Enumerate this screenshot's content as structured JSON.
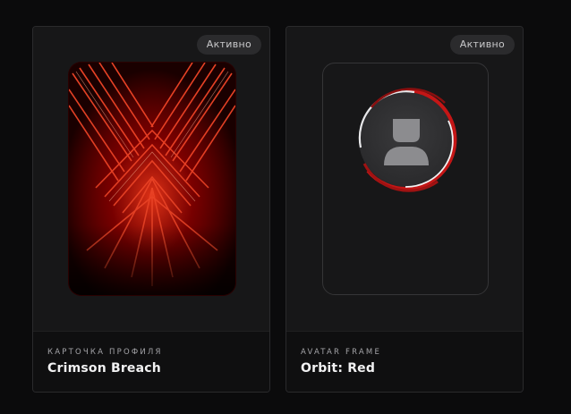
{
  "cards": [
    {
      "badge": "Активно",
      "kicker": "КАРТОЧКА ПРОФИЛЯ",
      "title": "Crimson Breach",
      "icon": "crimson-art-image"
    },
    {
      "badge": "Активно",
      "kicker": "AVATAR FRAME",
      "title": "Orbit: Red",
      "icon": "user-silhouette-icon"
    }
  ],
  "colors": {
    "background": "#0b0b0c",
    "card": "#161617",
    "accent": "#e02020"
  }
}
